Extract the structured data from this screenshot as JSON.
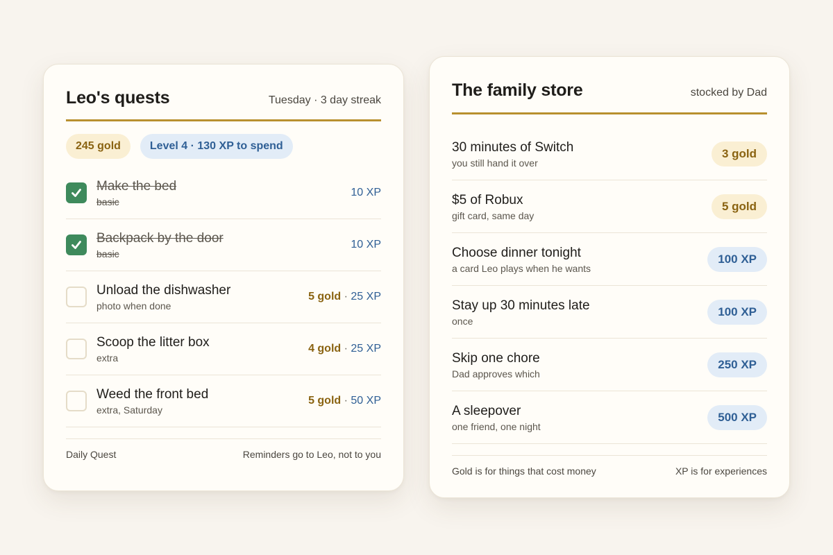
{
  "quests": {
    "title": "Leo's quests",
    "subtitle": "Tuesday · 3 day streak",
    "gold_badge": "245 gold",
    "level_badge": "Level 4 · 130 XP to spend",
    "items": [
      {
        "name": "Make the bed",
        "note": "basic",
        "done": true,
        "gold": "",
        "xp": "10 XP"
      },
      {
        "name": "Backpack by the door",
        "note": "basic",
        "done": true,
        "gold": "",
        "xp": "10 XP"
      },
      {
        "name": "Unload the dishwasher",
        "note": "photo when done",
        "done": false,
        "gold": "5 gold",
        "xp": "25 XP"
      },
      {
        "name": "Scoop the litter box",
        "note": "extra",
        "done": false,
        "gold": "4 gold",
        "xp": "25 XP"
      },
      {
        "name": "Weed the front bed",
        "note": "extra, Saturday",
        "done": false,
        "gold": "5 gold",
        "xp": "50 XP"
      }
    ],
    "separator": "·",
    "footer_left": "Daily Quest",
    "footer_right": "Reminders go to Leo, not to you"
  },
  "store": {
    "title": "The family store",
    "subtitle": "stocked by Dad",
    "items": [
      {
        "name": "30 minutes of Switch",
        "note": "you still hand it over",
        "price": "3 gold",
        "currency": "gold"
      },
      {
        "name": "$5 of Robux",
        "note": "gift card, same day",
        "price": "5 gold",
        "currency": "gold"
      },
      {
        "name": "Choose dinner tonight",
        "note": "a card Leo plays when he wants",
        "price": "100 XP",
        "currency": "xp"
      },
      {
        "name": "Stay up 30 minutes late",
        "note": "once",
        "price": "100 XP",
        "currency": "xp"
      },
      {
        "name": "Skip one chore",
        "note": "Dad approves which",
        "price": "250 XP",
        "currency": "xp"
      },
      {
        "name": "A sleepover",
        "note": "one friend, one night",
        "price": "500 XP",
        "currency": "xp"
      }
    ],
    "footer_left": "Gold is for things that cost money",
    "footer_right": "XP is for experiences"
  },
  "colors": {
    "background": "#f8f4ee",
    "card": "#fffdf8",
    "accent_rule": "#b8902f",
    "gold_text": "#8a6311",
    "gold_fill": "#faefd3",
    "xp_text": "#2f5f95",
    "xp_fill": "#e2ecf7",
    "check_done": "#3e8a5c"
  }
}
